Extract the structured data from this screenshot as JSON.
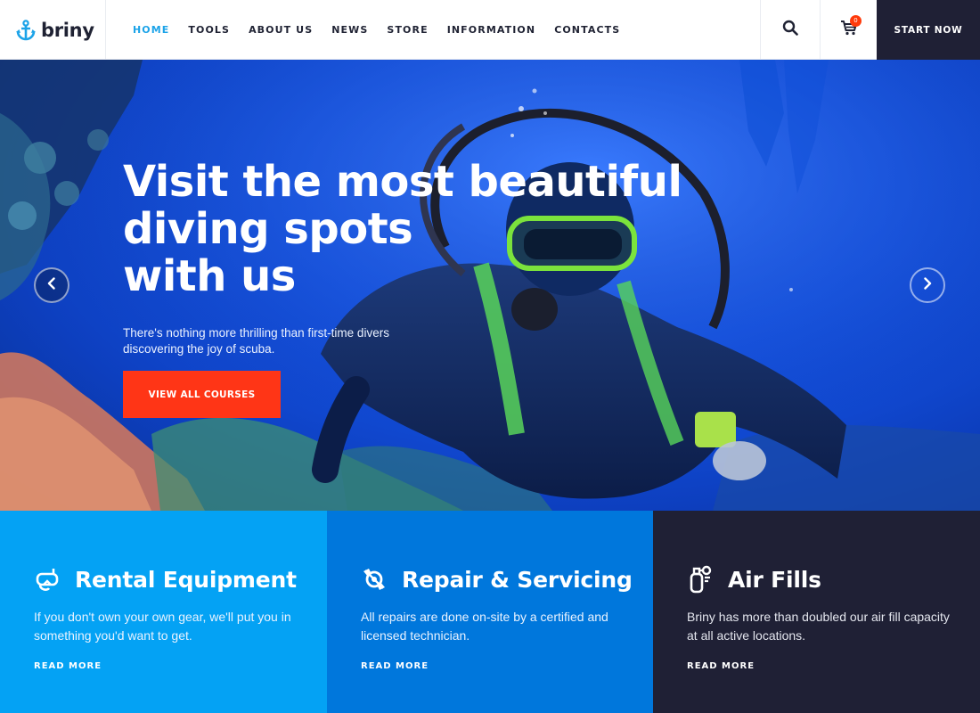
{
  "brand": {
    "name": "briny",
    "logo_icon": "anchor-icon",
    "accent": "#1ca3e8"
  },
  "nav": {
    "items": [
      {
        "label": "HOME",
        "active": true
      },
      {
        "label": "TOOLS",
        "active": false
      },
      {
        "label": "ABOUT US",
        "active": false
      },
      {
        "label": "NEWS",
        "active": false
      },
      {
        "label": "STORE",
        "active": false
      },
      {
        "label": "INFORMATION",
        "active": false
      },
      {
        "label": "CONTACTS",
        "active": false
      }
    ]
  },
  "header": {
    "search_icon": "search-icon",
    "cart_icon": "cart-icon",
    "cart_count": "0",
    "cta_label": "START NOW"
  },
  "hero": {
    "title": "Visit the most beautiful\ndiving spots\nwith us",
    "subtitle": "There's nothing more thrilling than first-time divers discovering the joy of scuba.",
    "cta_label": "VIEW ALL COURSES",
    "prev_icon": "chevron-left-icon",
    "next_icon": "chevron-right-icon"
  },
  "features": [
    {
      "icon": "snorkel-mask-icon",
      "title": "Rental Equipment",
      "text": "If you don't own your own gear, we'll put you in something you'd want to get.",
      "link": "READ MORE",
      "color": "#04a2f4"
    },
    {
      "icon": "wrench-gear-icon",
      "title": "Repair & Servicing",
      "text": "All repairs are done on-site by a certified and licensed technician.",
      "link": "READ MORE",
      "color": "#0077dc"
    },
    {
      "icon": "air-tank-icon",
      "title": "Air Fills",
      "text": "Briny has more than doubled our air fill capacity at all active locations.",
      "link": "READ MORE",
      "color": "#1f2035"
    }
  ],
  "colors": {
    "cta_red": "#ff3516",
    "dark": "#1f2035",
    "hero_blue": "#1657ec"
  }
}
